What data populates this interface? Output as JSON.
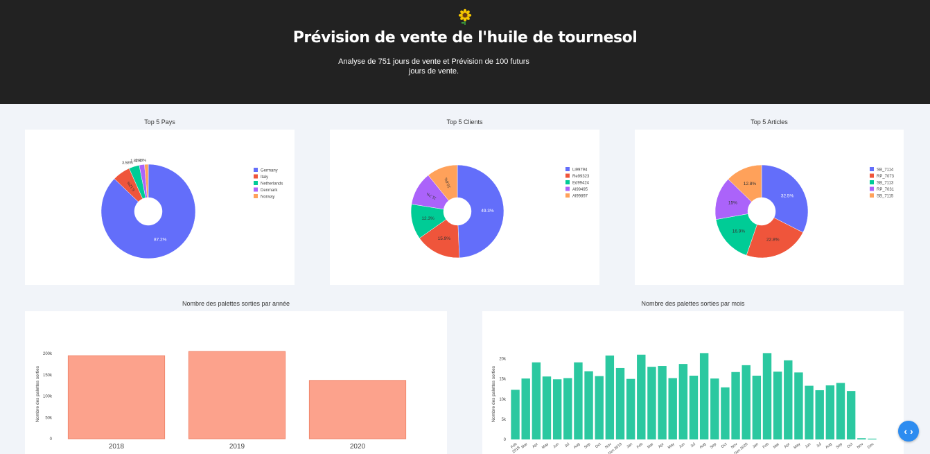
{
  "header": {
    "logo_icon": "sunflower-icon",
    "title": "Prévision de vente de l'huile de tournesol",
    "subtitle": "Analyse de 751 jours de vente et Prévision de 100 futurs jours de vente."
  },
  "fab": {
    "icon": "code-arrows-icon",
    "label": "‹ ›"
  },
  "chart_data": [
    {
      "type": "pie",
      "hole": true,
      "title": "Top 5 Pays",
      "labels": [
        "Germany",
        "Italy",
        "Netherlands",
        "Denmark",
        "Norway"
      ],
      "values": [
        87.2,
        6.12,
        3.58,
        1.82,
        1.28
      ],
      "value_labels": [
        "87.2%",
        "6.12%",
        "3.58%",
        "1.82%",
        "1.28%"
      ],
      "colors": [
        "#636efa",
        "#ef553b",
        "#00cc96",
        "#ab63fa",
        "#ffa15a"
      ],
      "legend": "right"
    },
    {
      "type": "pie",
      "hole": true,
      "title": "Top 5 Clients",
      "labels": [
        "Li99794",
        "Re99323",
        "Ed99424",
        "Al99495",
        "Al99897"
      ],
      "values": [
        49.3,
        15.9,
        12.3,
        11.7,
        10.8
      ],
      "value_labels": [
        "49.3%",
        "15.9%",
        "12.3%",
        "11.7%",
        "10.8%"
      ],
      "colors": [
        "#636efa",
        "#ef553b",
        "#00cc96",
        "#ab63fa",
        "#ffa15a"
      ],
      "legend": "right"
    },
    {
      "type": "pie",
      "hole": true,
      "title": "Top 5 Articles",
      "labels": [
        "SB_7114",
        "RP_7073",
        "SB_7113",
        "RP_7031",
        "SB_7115"
      ],
      "values": [
        32.5,
        22.8,
        16.9,
        15,
        12.8
      ],
      "value_labels": [
        "32.5%",
        "22.8%",
        "16.9%",
        "15%",
        "12.8%"
      ],
      "colors": [
        "#636efa",
        "#ef553b",
        "#00cc96",
        "#ab63fa",
        "#ffa15a"
      ],
      "legend": "right"
    },
    {
      "type": "bar",
      "title": "Nombre des palettes sorties par année",
      "ylabel": "Nombre des palettes sorties",
      "categories": [
        "2018",
        "2019",
        "2020"
      ],
      "values": [
        195000,
        205000,
        137000
      ],
      "ylim": [
        0,
        210000
      ],
      "yticks": [
        0,
        50000,
        100000,
        150000,
        200000
      ],
      "ytick_labels": [
        "0",
        "50k",
        "100k",
        "150k",
        "200k"
      ],
      "color": "#fca28c"
    },
    {
      "type": "bar",
      "title": "Nombre des palettes sorties par mois",
      "ylabel": "Nombre des palettes sorties",
      "categories": [
        "Feb 2018",
        "Mar",
        "Apr",
        "May",
        "Jun",
        "Jul",
        "Aug",
        "Sep",
        "Oct",
        "Nov",
        "Dec",
        "Jan 2019",
        "Feb",
        "Mar",
        "Apr",
        "May",
        "Jun",
        "Jul",
        "Aug",
        "Sep",
        "Oct",
        "Nov",
        "Dec",
        "Jan 2020",
        "Feb",
        "Mar",
        "Apr",
        "May",
        "Jun",
        "Jul",
        "Aug",
        "Sep",
        "Oct",
        "Nov",
        "Dec"
      ],
      "xtick_labels": [
        "Feb\n2018",
        "Mar",
        "Apr",
        "May",
        "Jun",
        "Jul",
        "Aug",
        "Sep",
        "Oct",
        "Nov",
        "Dec 2019",
        "Jan",
        "Feb",
        "Mar",
        "Apr",
        "May",
        "Jun",
        "Jul",
        "Aug",
        "Sep",
        "Oct",
        "Nov",
        "Dec 2020",
        "Jan",
        "Feb",
        "Mar",
        "Apr",
        "May",
        "Jun",
        "Jul",
        "Aug",
        "Sep",
        "Oct",
        "Nov",
        "Dec"
      ],
      "values": [
        12300,
        15100,
        19100,
        15600,
        14900,
        15200,
        19100,
        16900,
        15700,
        20800,
        17700,
        15000,
        21000,
        18000,
        18200,
        15200,
        18700,
        15800,
        21400,
        15100,
        12900,
        16700,
        18400,
        15800,
        21400,
        16800,
        19600,
        16600,
        13300,
        12200,
        13400,
        14000,
        12000,
        300,
        200
      ],
      "ylim": [
        0,
        22500
      ],
      "yticks": [
        0,
        5000,
        10000,
        15000,
        20000
      ],
      "ytick_labels": [
        "0",
        "5k",
        "10k",
        "15k",
        "20k"
      ],
      "color": "#2bc8a0"
    }
  ]
}
